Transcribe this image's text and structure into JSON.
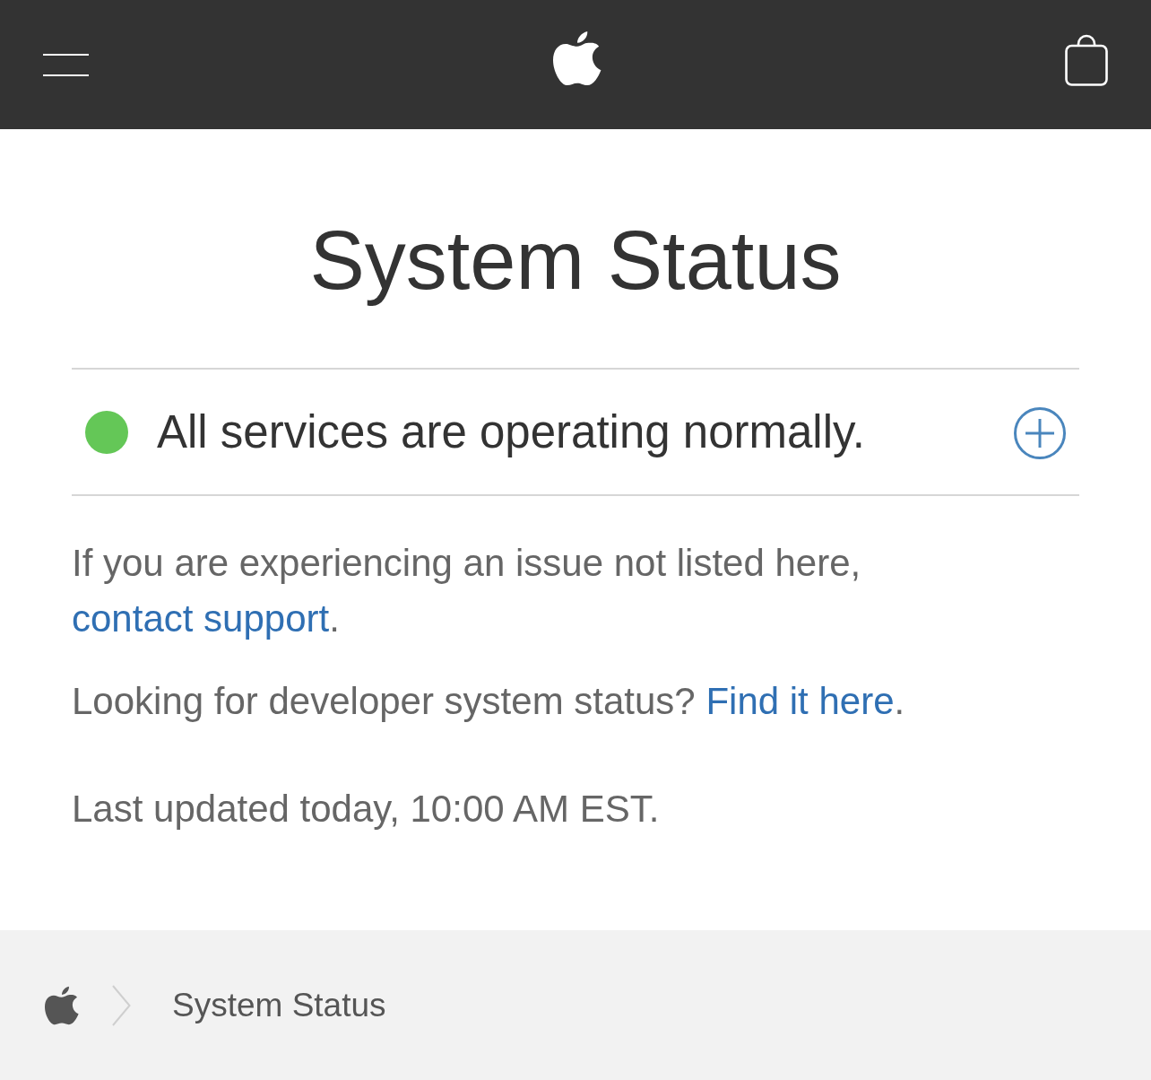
{
  "title": "System Status",
  "summary": {
    "color": "#64c757",
    "text": "All services are operating normally.",
    "expanded": false
  },
  "notes": [
    {
      "before": "If you are experiencing an issue not listed here, ",
      "link": "contact support",
      "after": "."
    },
    {
      "before": "Looking for developer system status? ",
      "link": "Find it here",
      "after": "."
    }
  ],
  "updated": "Last updated today, 10:00 AM EST.",
  "breadcrumb": {
    "current": "System Status"
  }
}
